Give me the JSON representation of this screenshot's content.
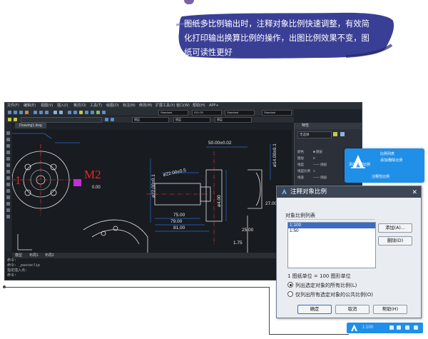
{
  "banner": {
    "lines": [
      "图纸多比例输出时，注释对象比例快速调整，有效简",
      "化打印输出换算比例的操作，出图比例效果不变，图",
      "纸可读性更好"
    ],
    "color": "#3a3f96"
  },
  "cad": {
    "menu": [
      "文件(F)",
      "编辑(E)",
      "视图(V)",
      "插入(I)",
      "格式(O)",
      "工具(T)",
      "绘图(D)",
      "标注(N)",
      "修改(M)",
      "扩展工具(X)",
      "窗口(W)",
      "帮助(H)",
      "APP+"
    ],
    "combos_row1": [
      "Standard",
      "ISO-25",
      "Standard",
      "Standard"
    ],
    "combos_row2": [
      "随层",
      "随层",
      "随层"
    ],
    "file_tab": "Drawing1.dwg",
    "drawing_texts": {
      "m2": "M2",
      "d1": "0.00",
      "d2": "50.00±0.02",
      "d3": "ø22.00±0.1",
      "d4": "ø22.00±0.5",
      "d5": "ø4.00",
      "d6": "ø14.00±0.1",
      "d7": "27.00",
      "d8": "75.00",
      "d9": "79.00",
      "d10": "81.00",
      "d11": "25.00",
      "d12": "1.75"
    },
    "model_tabs": [
      "模型",
      "布局1",
      "布局2"
    ],
    "command_lines": [
      "命令:",
      "命令: _pasteclip",
      "指定插入点:",
      "命令:"
    ]
  },
  "props": {
    "title": "特性",
    "selection": "无选择",
    "rows": [
      {
        "label": "颜色",
        "value": "■ 随层"
      },
      {
        "label": "图层",
        "value": "0"
      },
      {
        "label": "线型",
        "value": "—— 随层"
      },
      {
        "label": "线型比例",
        "value": "1"
      },
      {
        "label": "线宽",
        "value": "—— 随层"
      }
    ]
  },
  "popup": {
    "items": [
      "比例列表",
      "添加当前比例",
      "添加/删除比例",
      "注释性比例"
    ]
  },
  "dialog": {
    "title": "注释对象比例",
    "list_label": "对象比例列表",
    "scales": [
      "1:100",
      "1:50"
    ],
    "selected_index": 0,
    "add_button": "添加(A)...",
    "delete_button": "删除(D)",
    "unit_text": "1 图纸单位 = 100 图形单位",
    "radio1": "列出选定对象的所有比例(L)",
    "radio2": "仅列出所有选定对象的公共比例(O)",
    "radio_selected": 1,
    "ok": "确定",
    "cancel": "取消",
    "help": "帮助(H)"
  },
  "statusbar": {
    "scale": "1:100"
  }
}
